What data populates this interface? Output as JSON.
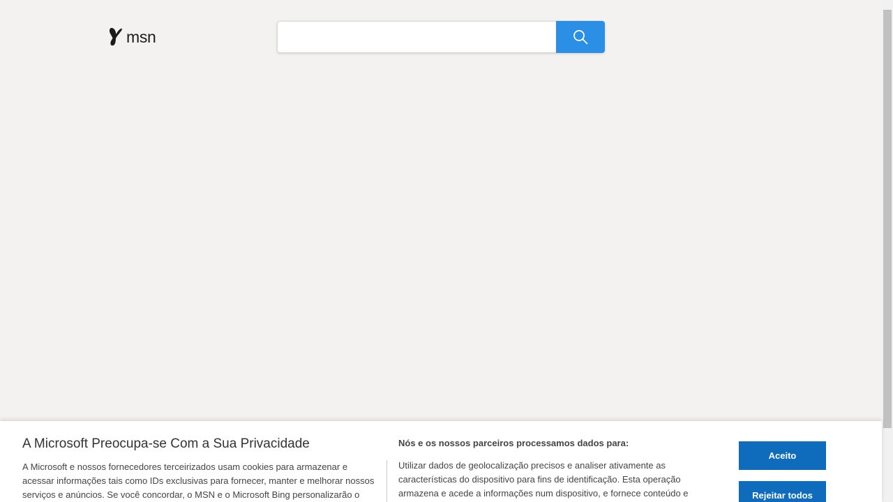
{
  "header": {
    "logo_text": "msn",
    "search": {
      "placeholder": "",
      "value": ""
    }
  },
  "consent": {
    "title": "A Microsoft Preocupa-se Com a Sua Privacidade",
    "body": "A Microsoft e nossos fornecedores terceirizados usam cookies para armazenar e acessar informações tais como IDs exclusivas para fornecer, manter e melhorar nossos serviços e anúncios. Se você concordar, o MSN e o Microsoft Bing personalizarão o conteúdo e",
    "purposes_title": "Nós e os nossos parceiros processamos dados para:",
    "purposes_body": "Utilizar dados de geolocalização precisos e analiser ativamente as características do dispositivo para fins de identificação. Esta operação armazena e acede a informações num dispositivo, e fornece conteúdo e",
    "accept_label": "Aceito",
    "reject_label": "Rejeitar todos"
  },
  "colors": {
    "background": "#f3f2f1",
    "search_button": "#2b8fe5",
    "consent_button": "#0f6cbd"
  },
  "icons": {
    "logo": "msn-butterfly-icon",
    "search": "search-icon"
  }
}
